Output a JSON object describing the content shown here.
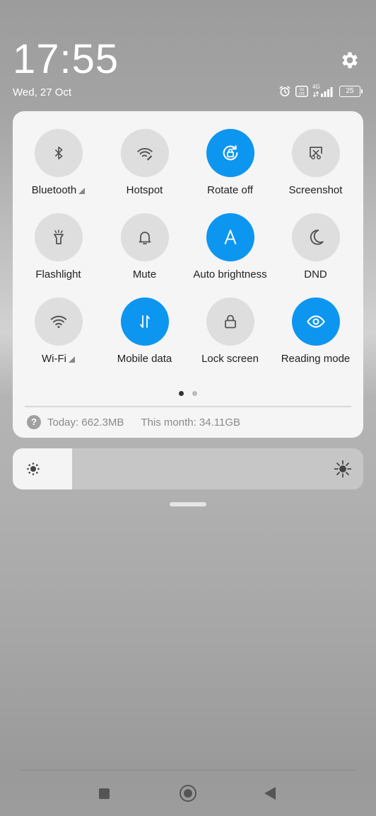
{
  "status": {
    "time": "17:55",
    "date": "Wed, 27 Oct",
    "network_type": "4G",
    "volte_badge": "Vo LTE",
    "battery": "25",
    "icons": [
      "alarm-icon",
      "volte-icon",
      "signal-icon",
      "battery-icon"
    ]
  },
  "settings_icon": "gear-icon",
  "tiles": [
    {
      "label": "Bluetooth",
      "icon": "bluetooth-icon",
      "active": false,
      "has_more": true
    },
    {
      "label": "Hotspot",
      "icon": "hotspot-icon",
      "active": false,
      "has_more": false
    },
    {
      "label": "Rotate off",
      "icon": "rotate-lock-icon",
      "active": true,
      "has_more": false
    },
    {
      "label": "Screenshot",
      "icon": "screenshot-icon",
      "active": false,
      "has_more": false
    },
    {
      "label": "Flashlight",
      "icon": "flashlight-icon",
      "active": false,
      "has_more": false
    },
    {
      "label": "Mute",
      "icon": "bell-icon",
      "active": false,
      "has_more": false
    },
    {
      "label": "Auto brightness",
      "icon": "auto-brightness-icon",
      "active": true,
      "has_more": false
    },
    {
      "label": "DND",
      "icon": "moon-icon",
      "active": false,
      "has_more": false
    },
    {
      "label": "Wi-Fi",
      "icon": "wifi-icon",
      "active": false,
      "has_more": true
    },
    {
      "label": "Mobile data",
      "icon": "mobile-data-icon",
      "active": true,
      "has_more": false
    },
    {
      "label": "Lock screen",
      "icon": "lock-icon",
      "active": false,
      "has_more": false
    },
    {
      "label": "Reading mode",
      "icon": "eye-icon",
      "active": true,
      "has_more": false
    }
  ],
  "page_indicator": {
    "current": 1,
    "total": 2
  },
  "data_usage": {
    "help_glyph": "?",
    "today": "Today: 662.3MB",
    "month": "This month: 34.11GB"
  },
  "brightness": {
    "level": 0.17
  },
  "colors": {
    "accent": "#0c96f0",
    "tile_off": "#dedede",
    "panel": "#f5f5f5"
  }
}
